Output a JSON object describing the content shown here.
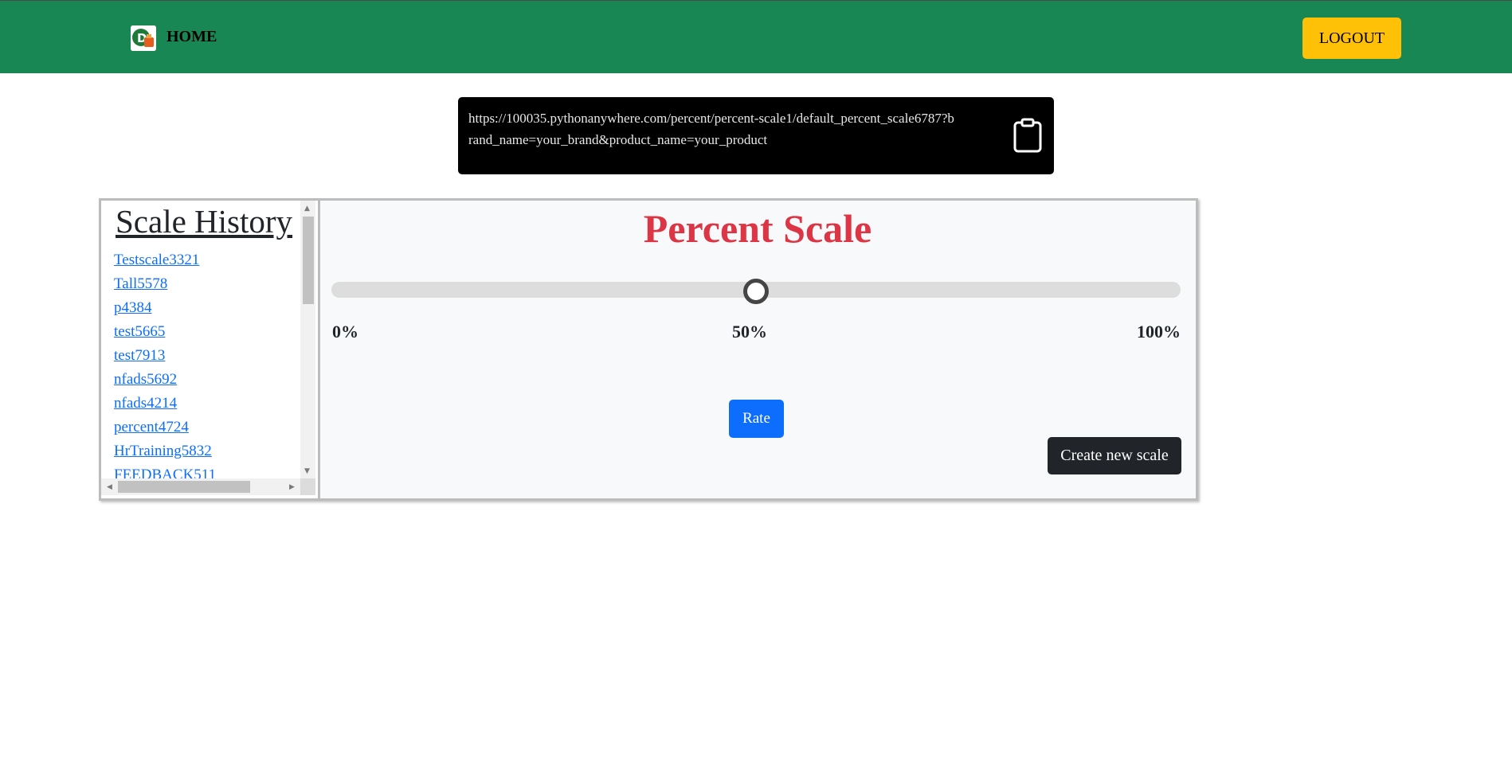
{
  "nav": {
    "home_label": "HOME",
    "logout_label": "LOGOUT",
    "logo_icon": "brand-logo-icon",
    "bar_color": "#198754"
  },
  "share": {
    "url": "https://100035.pythonanywhere.com/percent/percent-scale1/default_percent_scale6787?brand_name=your_brand&product_name=your_product",
    "copy_icon": "clipboard-icon"
  },
  "history": {
    "title": "Scale History",
    "items": [
      "Testscale3321",
      "Tall5578",
      "p4384",
      "test5665",
      "test7913",
      "nfads5692",
      "nfads4214",
      "percent4724",
      "HrTraining5832",
      "FEEDBACK511"
    ]
  },
  "scale": {
    "title": "Percent Scale",
    "title_color": "#dc3545",
    "slider_value_percent": 50,
    "ticks": [
      "0%",
      "50%",
      "100%"
    ],
    "rate_label": "Rate",
    "create_label": "Create new scale"
  }
}
